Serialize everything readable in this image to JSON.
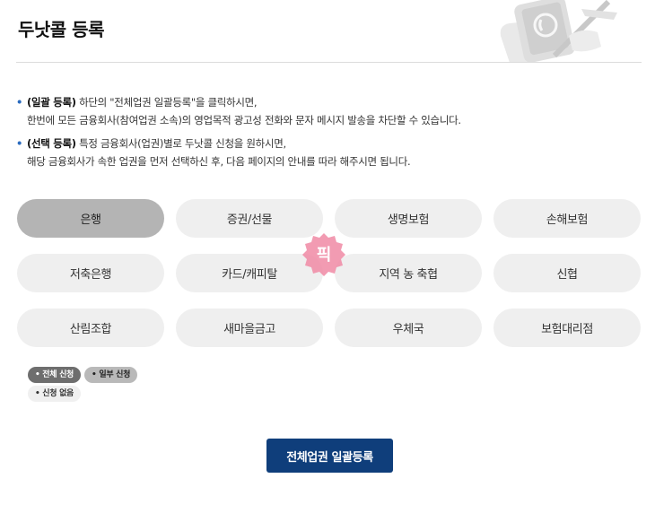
{
  "header": {
    "title": "두낫콜 등록"
  },
  "notes": [
    {
      "strong": "(일괄 등록)",
      "line1_rest": " 하단의 \"전체업권 일괄등록\"을 클릭하시면,",
      "line2": "한번에 모든 금융회사(참여업권 소속)의 영업목적 광고성 전화와 문자 메시지 발송을 차단할 수 있습니다."
    },
    {
      "strong": "(선택 등록)",
      "line1_rest": " 특정 금융회사(업권)별로 두낫콜 신청을 원하시면,",
      "line2": "해당 금융회사가 속한 업권을 먼저 선택하신 후, 다음 페이지의 안내를 따라 해주시면 됩니다."
    }
  ],
  "categories": [
    {
      "label": "은행",
      "selected": true
    },
    {
      "label": "증권/선물",
      "selected": false
    },
    {
      "label": "생명보험",
      "selected": false
    },
    {
      "label": "손해보험",
      "selected": false
    },
    {
      "label": "저축은행",
      "selected": false
    },
    {
      "label": "카드/캐피탈",
      "selected": false
    },
    {
      "label": "지역 농 축협",
      "selected": false
    },
    {
      "label": "신협",
      "selected": false
    },
    {
      "label": "산림조합",
      "selected": false
    },
    {
      "label": "새마을금고",
      "selected": false
    },
    {
      "label": "우체국",
      "selected": false
    },
    {
      "label": "보험대리점",
      "selected": false
    }
  ],
  "badge": {
    "label": "픽",
    "color": "#f08aa5"
  },
  "legend": {
    "full": "• 전체 신청",
    "partial": "• 일부 신청",
    "none": "• 신청 없음"
  },
  "submit": {
    "label": "전체업권 일괄등록",
    "color": "#0f3e7b"
  }
}
